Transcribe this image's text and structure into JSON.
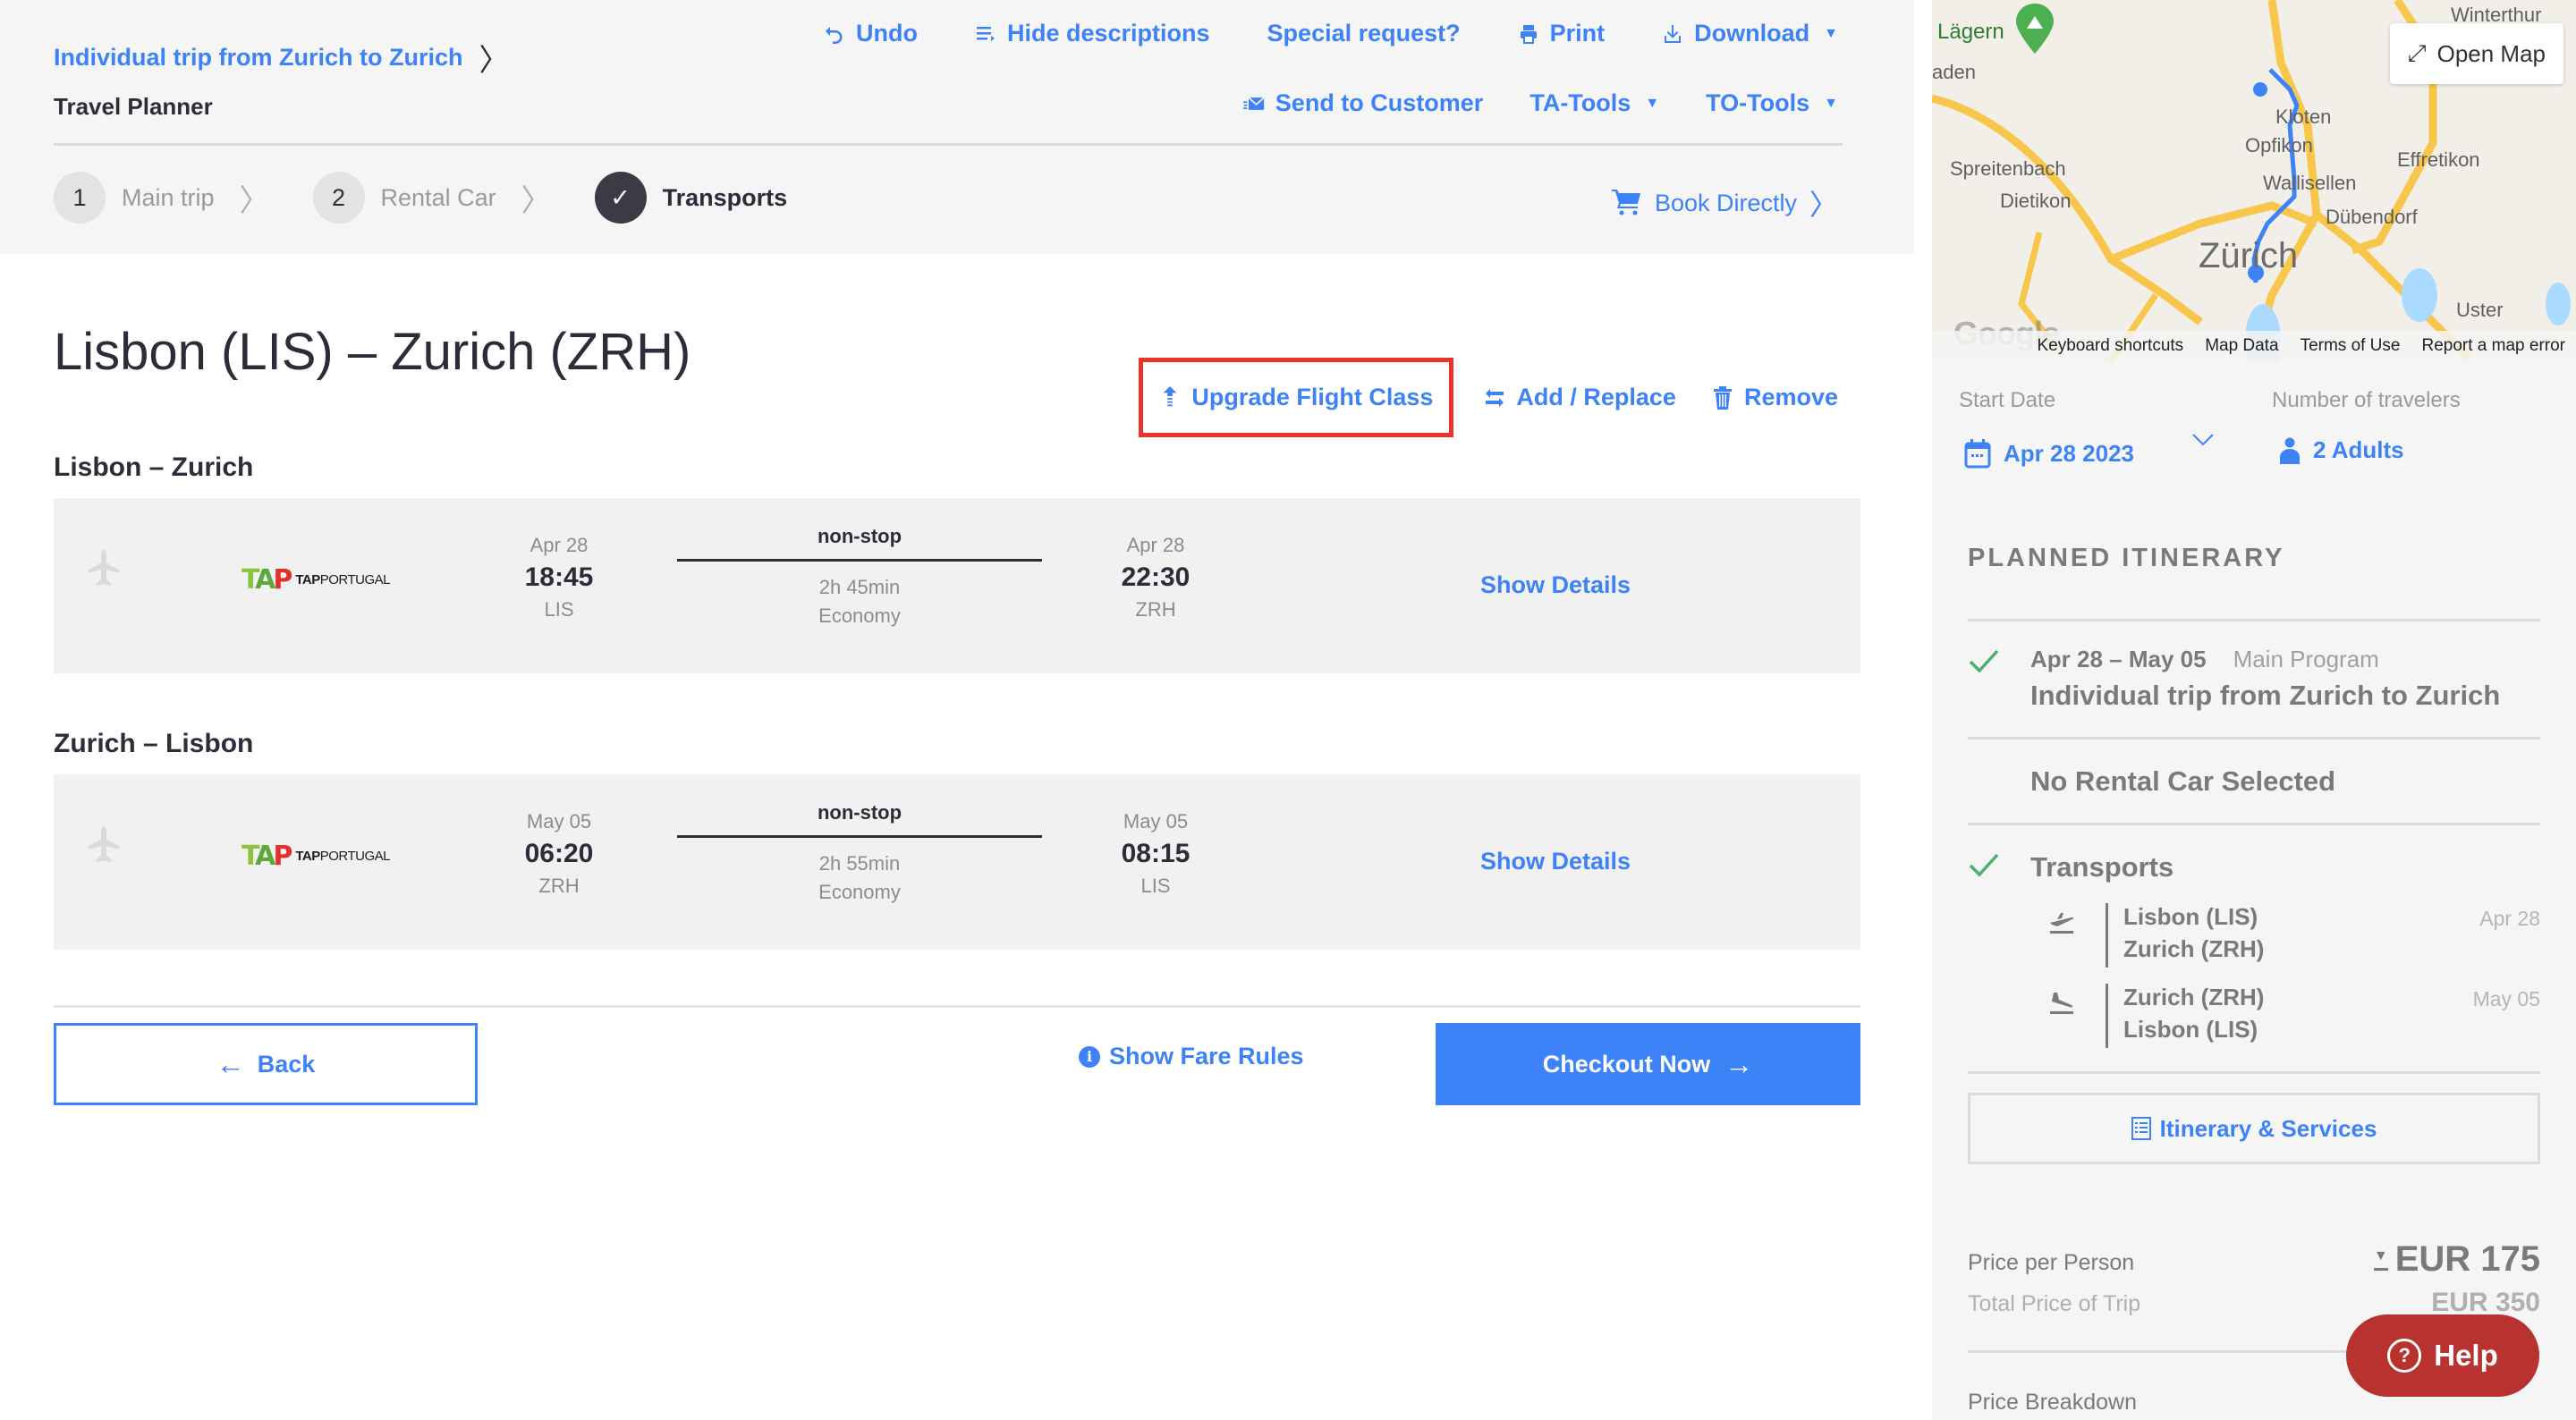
{
  "header": {
    "breadcrumb": "Individual trip from Zurich to Zurich",
    "title": "Travel Planner",
    "toolbar_row1": [
      {
        "label": "Undo",
        "icon": "undo-icon"
      },
      {
        "label": "Hide descriptions",
        "icon": "list-icon"
      },
      {
        "label": "Special request?",
        "icon": ""
      },
      {
        "label": "Print",
        "icon": "print-icon"
      },
      {
        "label": "Download",
        "icon": "download-icon",
        "dropdown": true
      }
    ],
    "toolbar_row2": [
      {
        "label": "Send to Customer",
        "icon": "mail-icon"
      },
      {
        "label": "TA-Tools",
        "dropdown": true
      },
      {
        "label": "TO-Tools",
        "dropdown": true
      }
    ],
    "steps": [
      {
        "number": "1",
        "label": "Main trip",
        "state": "inactive"
      },
      {
        "number": "2",
        "label": "Rental Car",
        "state": "inactive"
      },
      {
        "number": "✓",
        "label": "Transports",
        "state": "active"
      }
    ],
    "book_directly": "Book Directly"
  },
  "main": {
    "heading": "Lisbon (LIS) – Zurich (ZRH)",
    "actions": {
      "upgrade": "Upgrade Flight Class",
      "add_replace": "Add / Replace",
      "remove": "Remove"
    },
    "legs": [
      {
        "title": "Lisbon – Zurich",
        "airline": {
          "mark": "TAP",
          "name_bold": "TAP",
          "name": "PORTUGAL"
        },
        "departure": {
          "date": "Apr 28",
          "time": "18:45",
          "airport": "LIS"
        },
        "stops": "non-stop",
        "duration": "2h 45min",
        "cabin": "Economy",
        "arrival": {
          "date": "Apr 28",
          "time": "22:30",
          "airport": "ZRH"
        },
        "details_label": "Show Details"
      },
      {
        "title": "Zurich – Lisbon",
        "airline": {
          "mark": "TAP",
          "name_bold": "TAP",
          "name": "PORTUGAL"
        },
        "departure": {
          "date": "May 05",
          "time": "06:20",
          "airport": "ZRH"
        },
        "stops": "non-stop",
        "duration": "2h 55min",
        "cabin": "Economy",
        "arrival": {
          "date": "May 05",
          "time": "08:15",
          "airport": "LIS"
        },
        "details_label": "Show Details"
      }
    ],
    "back_label": "Back",
    "fare_rules_label": "Show Fare Rules",
    "checkout_label": "Checkout Now"
  },
  "sidebar": {
    "map": {
      "open_map": "Open Map",
      "labels": [
        "Lägern",
        "aden",
        "Kloten",
        "Opfikon",
        "Effretikon",
        "Spreitenbach",
        "Wallisellen",
        "Dietikon",
        "Dübendorf",
        "Zürich",
        "Uster",
        "Winterthur"
      ],
      "footer": [
        "Keyboard shortcuts",
        "Map Data",
        "Terms of Use",
        "Report a map error"
      ],
      "brand": "Google"
    },
    "start_date_label": "Start Date",
    "start_date": "Apr 28 2023",
    "travelers_label": "Number of travelers",
    "travelers": "2 Adults",
    "itinerary_heading": "PLANNED ITINERARY",
    "main_program": {
      "dates": "Apr 28 – May 05",
      "type": "Main Program",
      "title": "Individual trip from Zurich to Zurich"
    },
    "rental_car": "No Rental Car Selected",
    "transports_label": "Transports",
    "segments": [
      {
        "from": "Lisbon (LIS)",
        "to": "Zurich (ZRH)",
        "date": "Apr 28",
        "icon": "departure-icon"
      },
      {
        "from": "Zurich (ZRH)",
        "to": "Lisbon (LIS)",
        "date": "May 05",
        "icon": "arrival-icon"
      }
    ],
    "services_label": "Itinerary & Services",
    "price_per_person_label": "Price per Person",
    "price_per_person": "EUR 175",
    "total_price_label": "Total Price of Trip",
    "total_price": "EUR 350",
    "price_breakdown_label": "Price Breakdown",
    "help_label": "Help"
  },
  "colors": {
    "accent": "#3d82f6",
    "highlight": "#e8342a",
    "help": "#b83230",
    "check": "#4caf70"
  }
}
